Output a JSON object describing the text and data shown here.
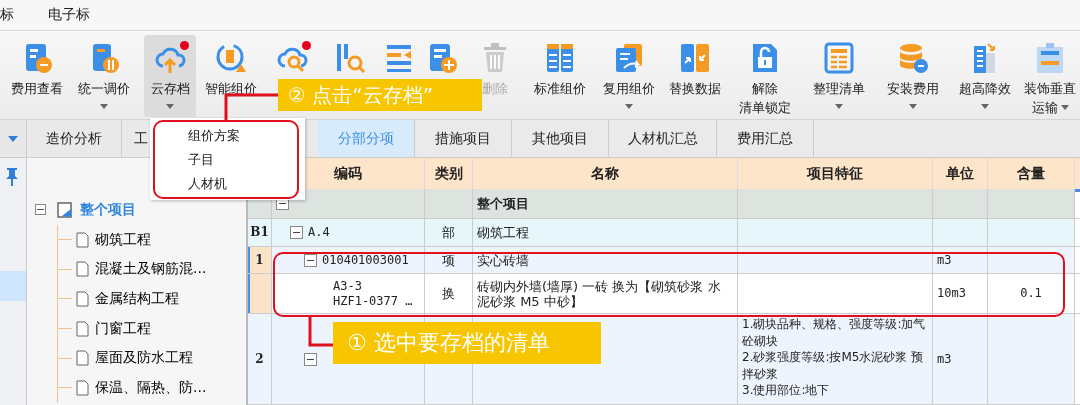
{
  "menu": [
    {
      "label": "标"
    },
    {
      "label": "电子标"
    }
  ],
  "toolbar": [
    {
      "label": "费用查看",
      "dropdown": false,
      "selected": false,
      "notify": false,
      "disabled": false
    },
    {
      "label": "统一调价",
      "dropdown": true,
      "selected": false,
      "notify": false,
      "disabled": false
    },
    {
      "label": "云存档",
      "dropdown": true,
      "selected": true,
      "notify": true,
      "disabled": false
    },
    {
      "label": "智能组价",
      "dropdown": false,
      "selected": false,
      "notify": false,
      "disabled": false
    },
    {
      "selected": false,
      "notify": true,
      "disabled": false
    },
    {
      "selected": false,
      "notify": false,
      "disabled": false
    },
    {
      "selected": false,
      "notify": false,
      "disabled": false
    },
    {
      "selected": false,
      "notify": false,
      "disabled": false
    },
    {
      "label": "删除",
      "dropdown": false,
      "selected": false,
      "notify": false,
      "disabled": true
    },
    {
      "label": "标准组价",
      "dropdown": false,
      "selected": false,
      "notify": false,
      "disabled": false
    },
    {
      "label": "复用组价",
      "dropdown": true,
      "selected": false,
      "notify": false,
      "disabled": false
    },
    {
      "label": "替换数据",
      "dropdown": false,
      "selected": false,
      "notify": false,
      "disabled": false
    },
    {
      "lines": [
        "解除",
        "清单锁定"
      ],
      "dropdown": false,
      "selected": false,
      "notify": false,
      "disabled": false
    },
    {
      "label": "整理清单",
      "dropdown": true,
      "selected": false,
      "notify": false,
      "disabled": false
    },
    {
      "label": "安装费用",
      "dropdown": true,
      "selected": false,
      "notify": false,
      "disabled": false
    },
    {
      "label": "超高降效",
      "dropdown": true,
      "selected": false,
      "notify": false,
      "disabled": false
    },
    {
      "lines": [
        "装饰垂直",
        "运输"
      ],
      "dropdown": true,
      "selected": false,
      "notify": false,
      "disabled": false
    }
  ],
  "side_tabs": [
    {
      "label": "造价分析",
      "selected": false
    },
    {
      "label": "工",
      "selected": false
    }
  ],
  "main_tabs": [
    {
      "label": "分部分项",
      "selected": true
    },
    {
      "label": "措施项目",
      "selected": false
    },
    {
      "label": "其他项目",
      "selected": false
    },
    {
      "label": "人材机汇总",
      "selected": false
    },
    {
      "label": "费用汇总",
      "selected": false
    }
  ],
  "tree": {
    "label": "整个项目",
    "expanded": true,
    "children": [
      {
        "label": "砌筑工程"
      },
      {
        "label": "混凝土及钢筋混..."
      },
      {
        "label": "金属结构工程"
      },
      {
        "label": "门窗工程"
      },
      {
        "label": "屋面及防水工程"
      },
      {
        "label": "保温、隔热、防..."
      }
    ]
  },
  "dropdown_menu": {
    "items": [
      {
        "label": "组价方案"
      },
      {
        "label": "子目"
      },
      {
        "label": "人材机"
      }
    ]
  },
  "grid": {
    "columns": [
      "编码",
      "类别",
      "名称",
      "项目特征",
      "单位",
      "含量"
    ],
    "rows": [
      {
        "kind": "whole",
        "name": "整个项目",
        "expanded": true,
        "selected": false,
        "children": [
          {
            "kind": "division",
            "num": "B1",
            "code": "A.4",
            "type": "部",
            "name": "砌筑工程",
            "expanded": true,
            "selected": false,
            "children": [
              {
                "kind": "bill",
                "num": "1",
                "code": "010401003001",
                "type": "项",
                "name": "实心砖墙",
                "unit": "m3",
                "expanded": true,
                "selected": true,
                "children": [
                  {
                    "kind": "quota",
                    "code": "A3-3\nHZF1-0377 …",
                    "type": "换",
                    "name": "砖砌内外墙(墙厚) 一砖 换为【砌筑砂浆 水泥砂浆 M5 中砂】",
                    "unit": "10m3",
                    "qty": "0.1",
                    "selected": true
                  }
                ]
              },
              {
                "kind": "bill",
                "num": "2",
                "features": "1.砌块品种、规格、强度等级:加气砼砌块\n2.砂浆强度等级:按M5水泥砂浆 预拌砂浆\n3.使用部位:地下",
                "unit": "m3",
                "expanded": true,
                "selected": false
              }
            ]
          }
        ]
      }
    ]
  },
  "callouts": [
    {
      "text": "② 点击“云存档”"
    },
    {
      "text": "① 选中要存档的清单"
    }
  ]
}
